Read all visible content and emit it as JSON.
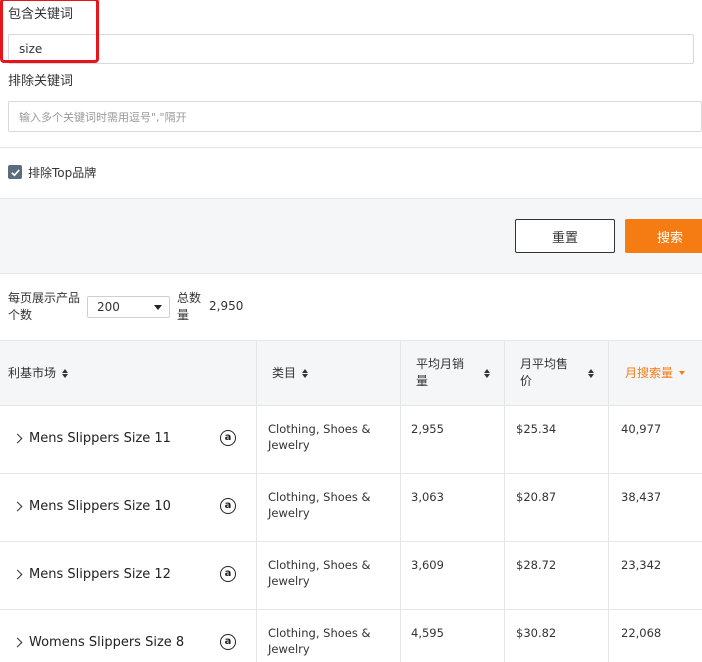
{
  "filters": {
    "include_label": "包含关键词",
    "include_value": "size",
    "exclude_label": "排除关键词",
    "exclude_placeholder": "输入多个关键词时需用逗号\",\"隔开",
    "exclude_top_brand_label": "排除Top品牌",
    "exclude_top_brand_checked": true
  },
  "actions": {
    "reset_label": "重置",
    "search_label": "搜索"
  },
  "pager": {
    "per_page_label": "每页展示产品个数",
    "per_page_value": "200",
    "total_label": "总数量",
    "total_value": "2,950"
  },
  "table": {
    "headers": [
      "利基市场",
      "类目",
      "平均月销量",
      "月平均售价",
      "月搜索量"
    ],
    "rows": [
      {
        "keyword": "Mens Slippers Size 11",
        "category": "Clothing, Shoes & Jewelry",
        "avg_monthly_sales": "2,955",
        "avg_price": "$25.34",
        "search_volume": "40,977"
      },
      {
        "keyword": "Mens Slippers Size 10",
        "category": "Clothing, Shoes & Jewelry",
        "avg_monthly_sales": "3,063",
        "avg_price": "$20.87",
        "search_volume": "38,437"
      },
      {
        "keyword": "Mens Slippers Size 12",
        "category": "Clothing, Shoes & Jewelry",
        "avg_monthly_sales": "3,609",
        "avg_price": "$28.72",
        "search_volume": "23,342"
      },
      {
        "keyword": "Womens Slippers Size 8",
        "category": "Clothing, Shoes & Jewelry",
        "avg_monthly_sales": "4,595",
        "avg_price": "$30.82",
        "search_volume": "22,068"
      }
    ]
  },
  "colors": {
    "accent": "#f47c12",
    "highlight": "#e8141b",
    "header_bg": "#f5f6f8"
  },
  "icons": {
    "row_expand": "chevron-right-icon",
    "marketplace": "amazon-icon",
    "sort": "sort-icon"
  }
}
